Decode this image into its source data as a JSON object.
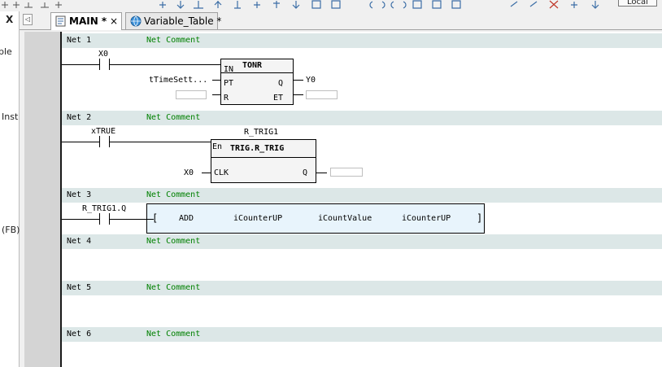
{
  "toolbar": {
    "local_label": "Local"
  },
  "left_panel": {
    "close_label": "X",
    "items": [
      {
        "text": "ple"
      },
      {
        "text": "Inst"
      },
      {
        "text": "(FB)"
      }
    ]
  },
  "tabs": [
    {
      "label": "MAIN *",
      "close": "×",
      "icon": "ladder-program-icon"
    },
    {
      "label": "Variable_Table *",
      "icon": "globe-variable-icon"
    }
  ],
  "networks": [
    {
      "label": "Net 1",
      "comment": "Net Comment"
    },
    {
      "label": "Net 2",
      "comment": "Net Comment"
    },
    {
      "label": "Net 3",
      "comment": "Net Comment"
    },
    {
      "label": "Net 4",
      "comment": "Net Comment"
    },
    {
      "label": "Net 5",
      "comment": "Net Comment"
    },
    {
      "label": "Net 6",
      "comment": "Net Comment"
    }
  ],
  "net1": {
    "contact": "X0",
    "block_title": "TONR",
    "pins": {
      "in": "IN",
      "pt": "PT",
      "r": "R",
      "q": "Q",
      "et": "ET"
    },
    "pt_var": "tTimeSett...",
    "q_out": "Y0"
  },
  "net2": {
    "contact": "xTRUE",
    "instance": "R_TRIG1",
    "en": "En",
    "block_title": "TRIG.R_TRIG",
    "clk_pin": "CLK",
    "q_pin": "Q",
    "clk_var": "X0"
  },
  "net3": {
    "contact": "R_TRIG1.Q",
    "bracket_open": "[",
    "op": "ADD",
    "arg1": "iCounterUP",
    "arg2": "iCountValue",
    "arg3": "iCounterUP",
    "bracket_close": "]"
  }
}
